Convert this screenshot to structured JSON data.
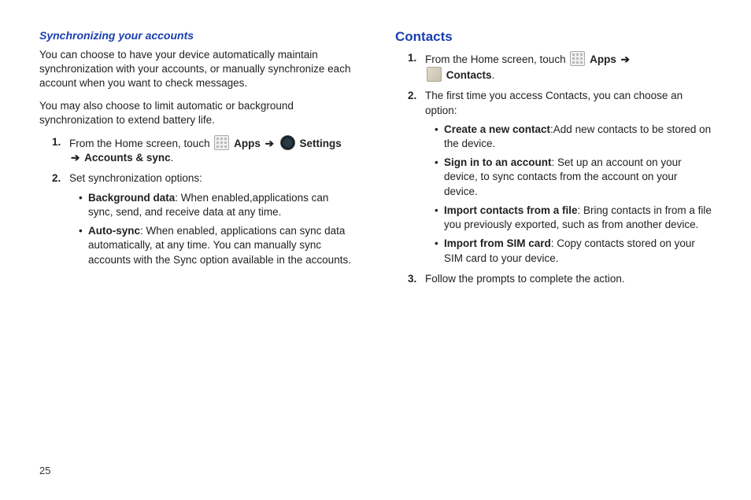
{
  "left": {
    "heading": "Synchronizing your accounts",
    "para1": "You can choose to have your device automatically maintain synchronization with your accounts, or manually synchronize each account when you want to check messages.",
    "para2": "You may also choose to limit automatic or background synchronization to extend battery life.",
    "steps": [
      {
        "num": "1.",
        "pre": "From the Home screen, touch ",
        "apps_label": "Apps",
        "settings_label": "Settings",
        "post_bold": "Accounts & sync",
        "post_tail": "."
      },
      {
        "num": "2.",
        "text": "Set synchronization options:"
      }
    ],
    "bullets": [
      {
        "term": "Background data",
        "desc": ": When enabled,applications can sync, send, and receive data at any time."
      },
      {
        "term": "Auto-sync",
        "desc": ": When enabled, applications can sync data automatically, at any time. You can manually sync accounts with the Sync option available in the accounts."
      }
    ]
  },
  "right": {
    "heading": "Contacts",
    "steps": [
      {
        "num": "1.",
        "pre": "From the Home screen, touch ",
        "apps_label": "Apps",
        "contacts_label": "Contacts",
        "tail": "."
      },
      {
        "num": "2.",
        "text": "The first time you access Contacts, you can choose an option:"
      }
    ],
    "bullets": [
      {
        "term": "Create a new contact",
        "desc": ":Add new contacts to be stored on the device."
      },
      {
        "term": "Sign in to an account",
        "desc": ": Set up an account on your device, to sync contacts from the account on your device."
      },
      {
        "term": "Import contacts from a file",
        "desc": ": Bring contacts in from a file you previously exported, such as from another device."
      },
      {
        "term": "Import from SIM card",
        "desc": ": Copy contacts stored on your SIM card to your device."
      }
    ],
    "step3": {
      "num": "3.",
      "text": "Follow the prompts to complete the action."
    }
  },
  "page_number": "25",
  "arrow_glyph": "➔"
}
